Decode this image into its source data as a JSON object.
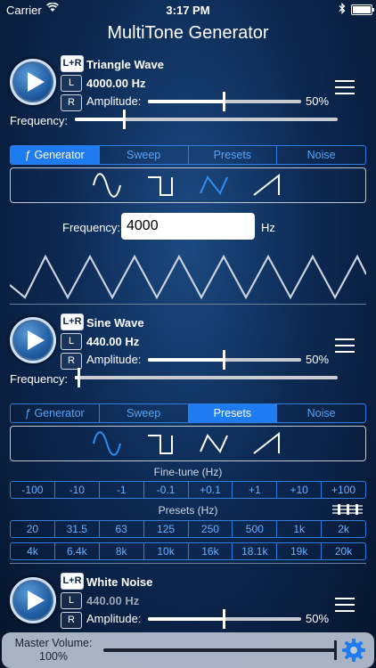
{
  "status_bar": {
    "carrier": "Carrier",
    "time": "3:17 PM"
  },
  "app_title": "MultiTone Generator",
  "channel_labels": {
    "lr": "L+R",
    "l": "L",
    "r": "R"
  },
  "amplitude_label": "Amplitude:",
  "frequency_label": "Frequency:",
  "hz_unit": "Hz",
  "tabs": [
    "ƒ Generator",
    "Sweep",
    "Presets",
    "Noise"
  ],
  "generator1": {
    "wave_name": "Triangle Wave",
    "freq_display": "4000.00 Hz",
    "amplitude_text": "50%",
    "amplitude_level": 0.5,
    "freq_slider_level": 0.19,
    "active_channel": "L+R",
    "selected_tab": 0,
    "selected_wave": "triangle",
    "freq_input_label": "Frequency:",
    "freq_input_value": "4000"
  },
  "generator2": {
    "wave_name": "Sine Wave",
    "freq_display": "440.00 Hz",
    "amplitude_text": "50%",
    "amplitude_level": 0.5,
    "freq_slider_level": 0.01,
    "active_channel": "L+R",
    "selected_tab": 2,
    "selected_wave": "sine",
    "finetune_label": "Fine-tune (Hz)",
    "finetune": [
      "-100",
      "-10",
      "-1",
      "-0.1",
      "+0.1",
      "+1",
      "+10",
      "+100"
    ],
    "presets_label": "Presets (Hz)",
    "presets_row1": [
      "20",
      "31.5",
      "63",
      "125",
      "250",
      "500",
      "1k",
      "2k"
    ],
    "presets_row2": [
      "4k",
      "6.4k",
      "8k",
      "10k",
      "16k",
      "18.1k",
      "19k",
      "20k"
    ]
  },
  "generator3": {
    "wave_name": "White Noise",
    "freq_display": "440.00 Hz",
    "amplitude_text": "50%",
    "amplitude_level": 0.5,
    "active_channel": "L+R"
  },
  "master": {
    "label": "Master Volume:",
    "value": "100%",
    "level": 1.0
  },
  "icons": {
    "play": "play-icon",
    "menu": "menu-icon",
    "gear": "gear-icon",
    "sliders": "sliders-icon"
  },
  "colors": {
    "accent": "#1f7cf0",
    "accent_text": "#5aa3f5"
  }
}
